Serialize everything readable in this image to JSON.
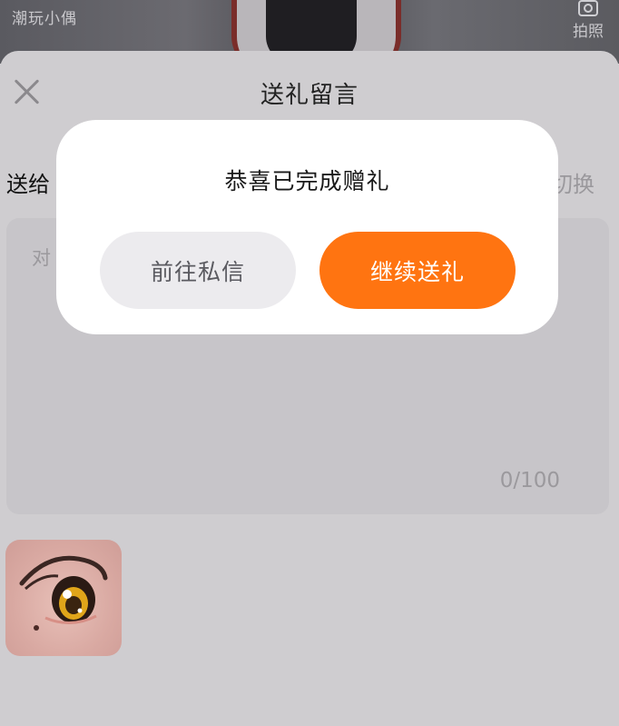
{
  "header": {
    "left_text": "潮玩小偶",
    "right_label": "拍照",
    "right_icon": "camera-icon"
  },
  "sheet": {
    "title": "送礼留言",
    "close_icon": "close-icon",
    "send_to_label": "送给",
    "switch_label": "切换",
    "message_placeholder": "对",
    "message_counter": "0/100"
  },
  "dialog": {
    "title": "恭喜已完成赠礼",
    "secondary_button": "前往私信",
    "primary_button": "继续送礼",
    "primary_color": "#ff7411"
  }
}
